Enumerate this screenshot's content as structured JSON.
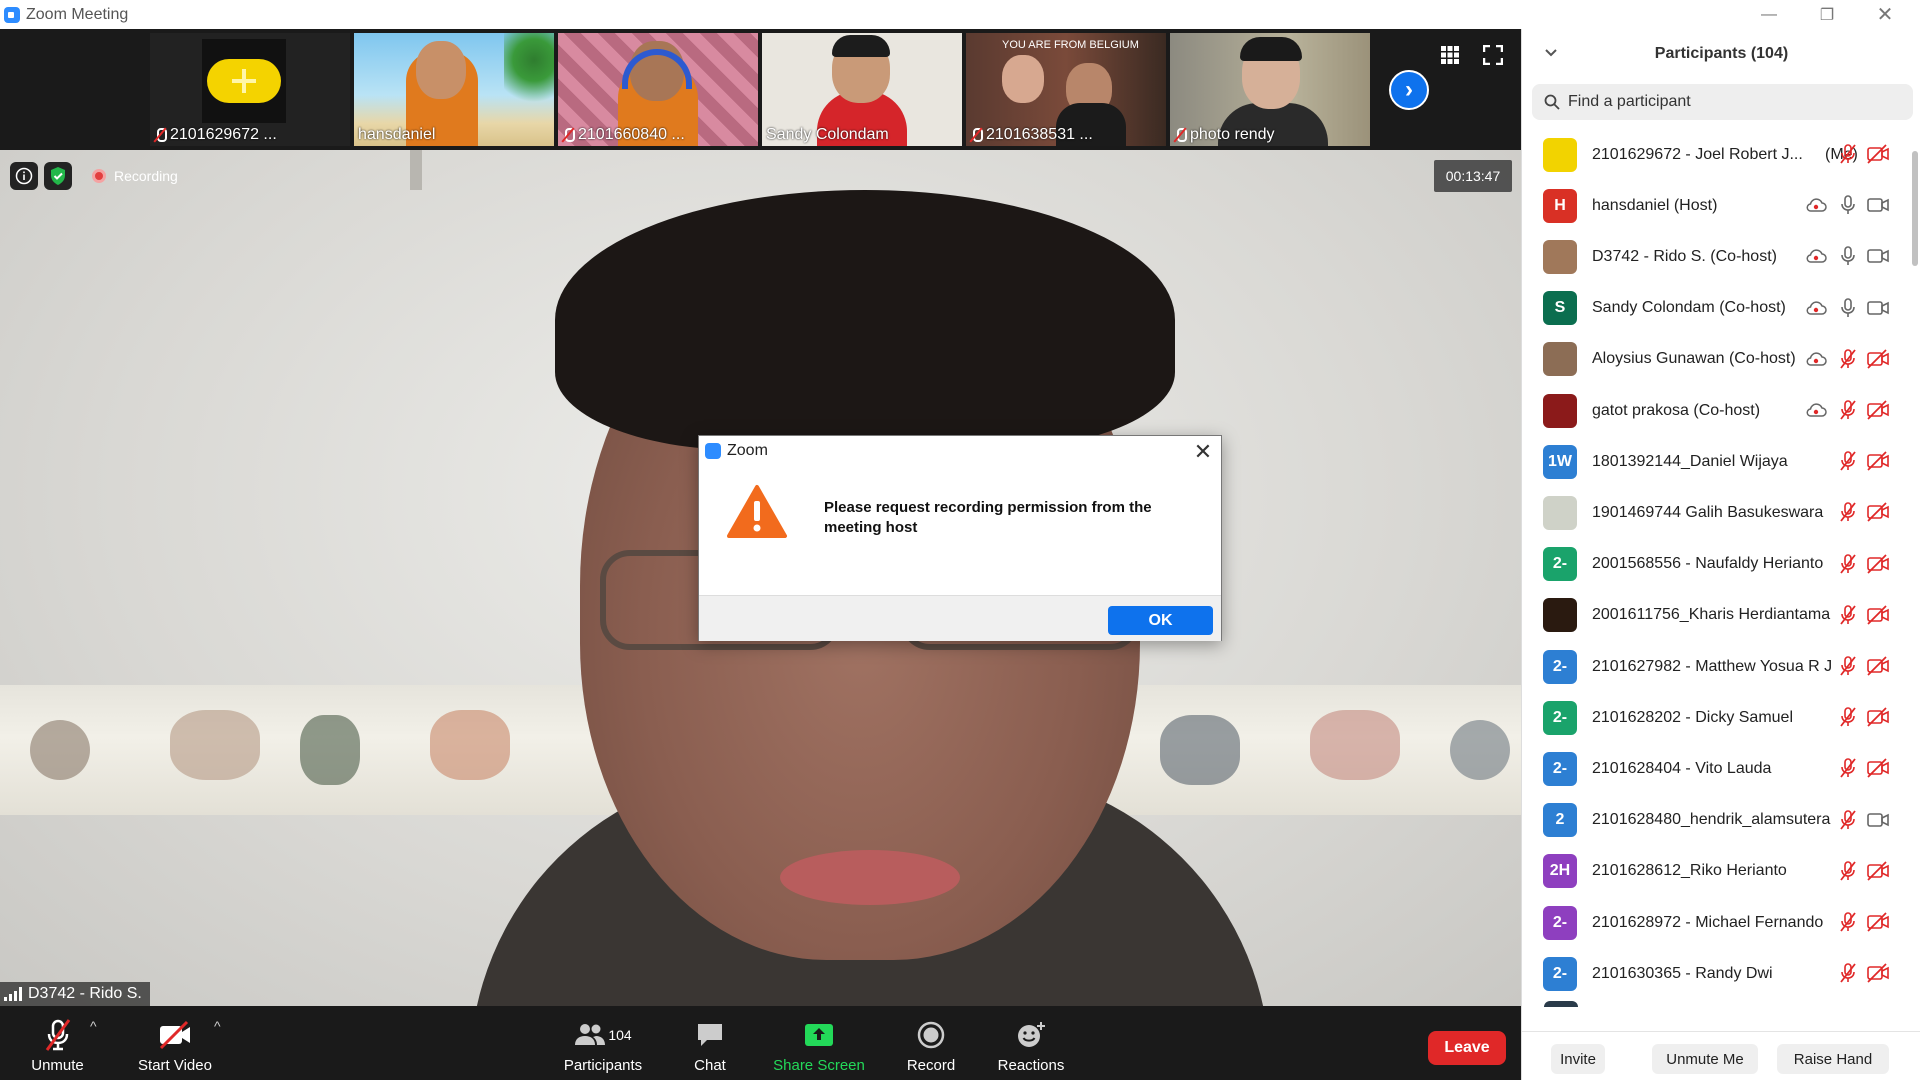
{
  "window": {
    "title": "Zoom Meeting"
  },
  "strip": {
    "thumbnails": [
      {
        "label": "2101629672 ...",
        "muted": true
      },
      {
        "label": "hansdaniel",
        "muted": false
      },
      {
        "label": "2101660840 ...",
        "muted": true
      },
      {
        "label": "Sandy Colondam",
        "muted": false
      },
      {
        "label": "2101638531 ...",
        "muted": true,
        "overlay": "YOU ARE FROM BELGIUM"
      },
      {
        "label": "photo rendy",
        "muted": true
      }
    ]
  },
  "status": {
    "recording_label": "Recording",
    "timer": "00:13:47"
  },
  "main": {
    "speaker_name": "D3742 - Rido S."
  },
  "dialog": {
    "title": "Zoom",
    "message": "Please request recording permission from the meeting host",
    "ok_label": "OK"
  },
  "toolbar": {
    "unmute": "Unmute",
    "start_video": "Start Video",
    "participants": "Participants",
    "participants_count": "104",
    "chat": "Chat",
    "share_screen": "Share Screen",
    "record": "Record",
    "reactions": "Reactions",
    "leave": "Leave"
  },
  "panel": {
    "title": "Participants (104)",
    "search_placeholder": "Find a participant",
    "participants": [
      {
        "name": "2101629672 - Joel Robert J...",
        "me": "(Me)",
        "avatar_text": "",
        "avatar_color": "#f2d300",
        "audio": "muted",
        "video": "off",
        "rec": false
      },
      {
        "name": "hansdaniel (Host)",
        "avatar_text": "H",
        "avatar_color": "#d93025",
        "audio": "on",
        "video": "on",
        "rec": true
      },
      {
        "name": "D3742 - Rido S. (Co-host)",
        "avatar_text": "",
        "avatar_color": "#a0785a",
        "audio": "on",
        "video": "on",
        "rec": true
      },
      {
        "name": "Sandy Colondam (Co-host)",
        "avatar_text": "S",
        "avatar_color": "#0b6e4f",
        "audio": "on",
        "video": "on",
        "rec": true
      },
      {
        "name": "Aloysius Gunawan (Co-host)",
        "avatar_text": "",
        "avatar_color": "#8c6d55",
        "audio": "muted",
        "video": "off",
        "rec": true
      },
      {
        "name": "gatot prakosa (Co-host)",
        "avatar_text": "",
        "avatar_color": "#8b1a1a",
        "audio": "muted",
        "video": "off",
        "rec": true
      },
      {
        "name": "1801392144_Daniel Wijaya",
        "avatar_text": "1W",
        "avatar_color": "#2d7fd3",
        "audio": "muted",
        "video": "off",
        "rec": false
      },
      {
        "name": "1901469744 Galih Basukeswara",
        "avatar_text": "",
        "avatar_color": "#cfd2c8",
        "audio": "muted",
        "video": "off",
        "rec": false
      },
      {
        "name": "2001568556 - Naufaldy Herianto",
        "avatar_text": "2-",
        "avatar_color": "#1aa36b",
        "audio": "muted",
        "video": "off",
        "rec": false
      },
      {
        "name": "2001611756_Kharis Herdiantama",
        "avatar_text": "",
        "avatar_color": "#2a1a10",
        "audio": "muted",
        "video": "off",
        "rec": false
      },
      {
        "name": "2101627982 - Matthew Yosua R J",
        "avatar_text": "2-",
        "avatar_color": "#2d7fd3",
        "audio": "muted",
        "video": "off",
        "rec": false
      },
      {
        "name": "2101628202 - Dicky Samuel",
        "avatar_text": "2-",
        "avatar_color": "#1aa36b",
        "audio": "muted",
        "video": "off",
        "rec": false
      },
      {
        "name": "2101628404 - Vito Lauda",
        "avatar_text": "2-",
        "avatar_color": "#2d7fd3",
        "audio": "muted",
        "video": "off",
        "rec": false
      },
      {
        "name": "2101628480_hendrik_alamsutera",
        "avatar_text": "2",
        "avatar_color": "#2d7fd3",
        "audio": "muted",
        "video": "on",
        "rec": false
      },
      {
        "name": "2101628612_Riko Herianto",
        "avatar_text": "2H",
        "avatar_color": "#8e3fbf",
        "audio": "muted",
        "video": "off",
        "rec": false
      },
      {
        "name": "2101628972 - Michael Fernando",
        "avatar_text": "2-",
        "avatar_color": "#8e3fbf",
        "audio": "muted",
        "video": "off",
        "rec": false
      },
      {
        "name": "2101630365 - Randy Dwi",
        "avatar_text": "2-",
        "avatar_color": "#2d7fd3",
        "audio": "muted",
        "video": "off",
        "rec": false
      }
    ],
    "invite": "Invite",
    "unmute_me": "Unmute Me",
    "raise_hand": "Raise Hand"
  }
}
